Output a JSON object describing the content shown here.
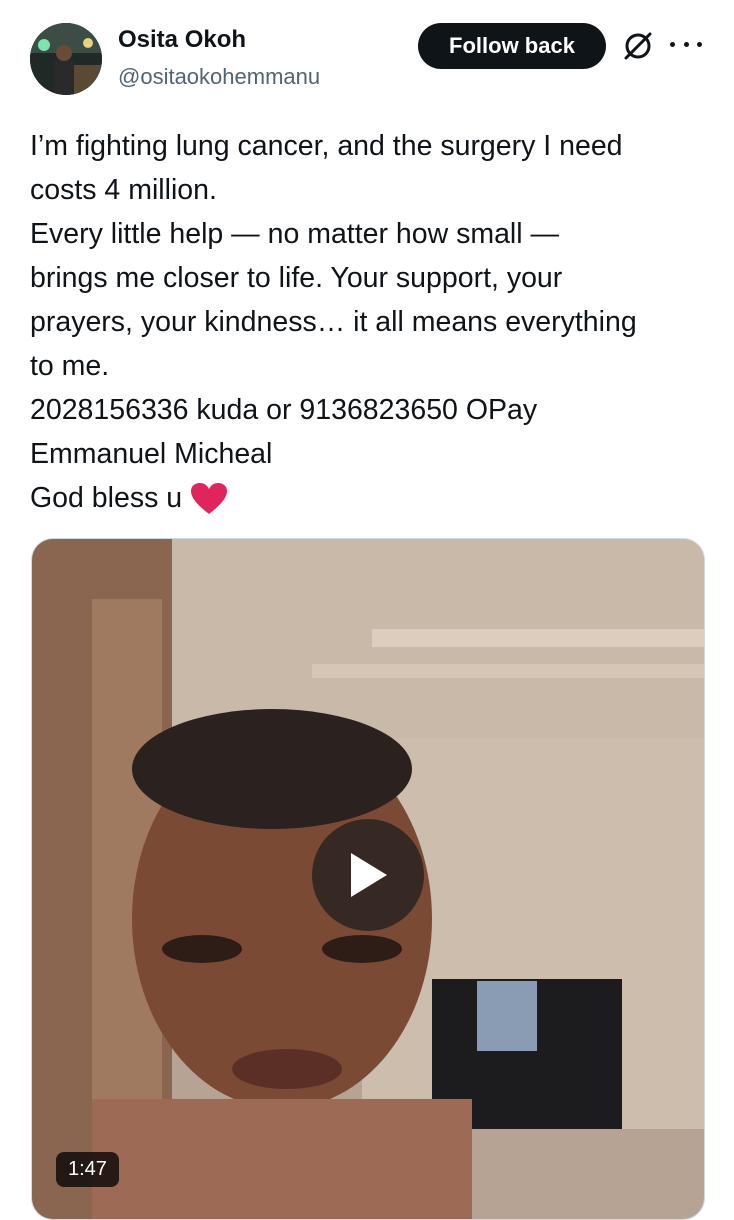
{
  "user": {
    "display_name": "Osita Okoh",
    "handle": "@ositaokohemmanu"
  },
  "actions": {
    "follow_label": "Follow back",
    "grok_icon": "grok-icon",
    "more_icon": "more-icon"
  },
  "tweet": {
    "lines": [
      "I’m fighting lung cancer, and the surgery I need",
      "costs 4 million.",
      "Every little help — no matter how small —",
      "brings me closer to life. Your support, your",
      "prayers, your kindness… it all means everything",
      "to me.",
      "2028156336 kuda or 9136823650 OPay",
      "Emmanuel Micheal",
      "God bless u"
    ],
    "trailing_icon": "red-heart-icon"
  },
  "media": {
    "type": "video",
    "duration": "1:47",
    "play_icon": "play-icon"
  },
  "colors": {
    "text": "#0f1419",
    "secondary": "#536471",
    "heart": "#e0245e"
  }
}
